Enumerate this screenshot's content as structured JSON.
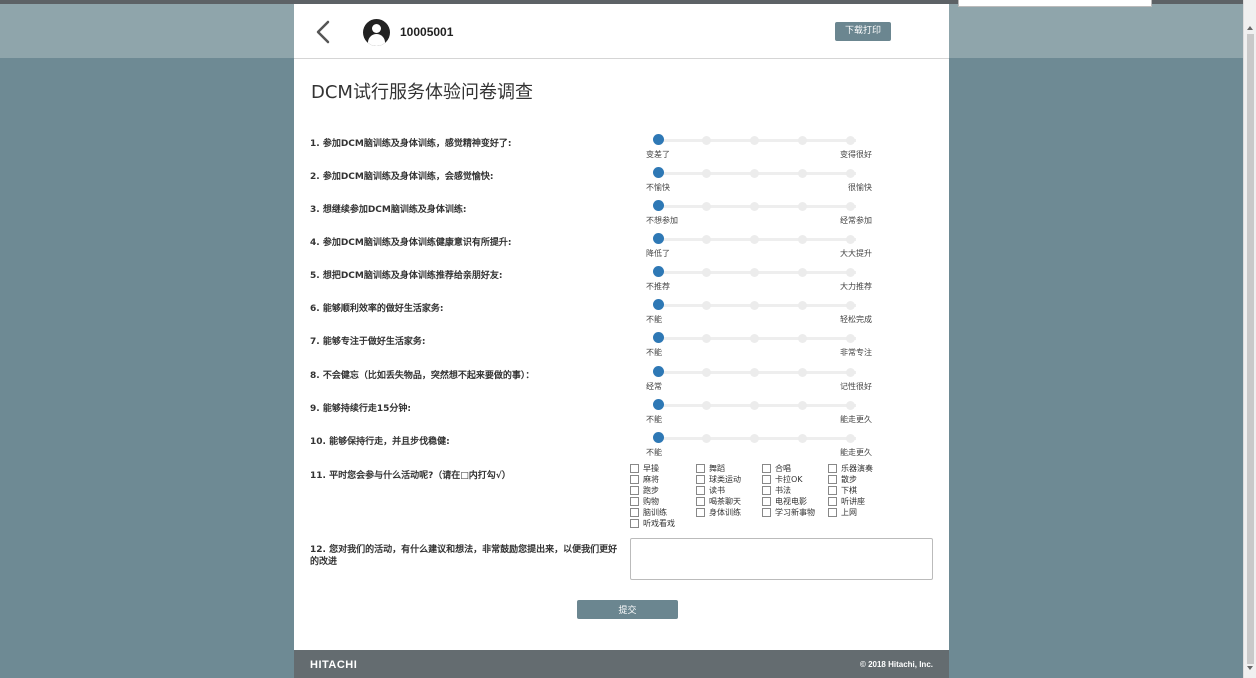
{
  "header": {
    "user_id": "10005001",
    "download_label": "下载打印"
  },
  "survey": {
    "title": "DCM试行服务体验问卷调查",
    "questions": [
      {
        "text": "1. 参加DCM脑训练及身体训练，感觉精神变好了:",
        "left": "变差了",
        "right": "变得很好",
        "value": 1
      },
      {
        "text": "2. 参加DCM脑训练及身体训练，会感觉愉快:",
        "left": "不愉快",
        "right": "很愉快",
        "value": 1
      },
      {
        "text": "3. 想继续参加DCM脑训练及身体训练:",
        "left": "不想参加",
        "right": "经常参加",
        "value": 1
      },
      {
        "text": "4. 参加DCM脑训练及身体训练健康意识有所提升:",
        "left": "降低了",
        "right": "大大提升",
        "value": 1
      },
      {
        "text": "5. 想把DCM脑训练及身体训练推荐给亲朋好友:",
        "left": "不推荐",
        "right": "大力推荐",
        "value": 1
      },
      {
        "text": "6. 能够顺利效率的做好生活家务:",
        "left": "不能",
        "right": "轻松完成",
        "value": 1
      },
      {
        "text": "7. 能够专注于做好生活家务:",
        "left": "不能",
        "right": "非常专注",
        "value": 1
      },
      {
        "text": "8. 不会健忘（比如丢失物品，突然想不起来要做的事）：",
        "left": "经常",
        "right": "记性很好",
        "value": 1
      },
      {
        "text": "9. 能够持续行走15分钟:",
        "left": "不能",
        "right": "能走更久",
        "value": 1
      },
      {
        "text": "10. 能够保持行走，并且步伐稳健:",
        "left": "不能",
        "right": "能走更久",
        "value": 1
      }
    ],
    "activities_question": "11. 平时您会参与什么活动呢?（请在□内打勾√）",
    "activities": [
      "早操",
      "舞蹈",
      "合唱",
      "乐器演奏",
      "麻将",
      "球类运动",
      "卡拉OK",
      "散步",
      "跑步",
      "读书",
      "书法",
      "下棋",
      "购物",
      "喝茶聊天",
      "电视电影",
      "听讲座",
      "脑训练",
      "身体训练",
      "学习新事物",
      "上网",
      "听戏看戏"
    ],
    "feedback_question": "12. 您对我们的活动，有什么建议和想法，非常鼓励您提出来，以便我们更好的改进",
    "feedback_value": "",
    "submit_label": "提交"
  },
  "footer": {
    "brand": "HITACHI",
    "copyright": "© 2018 Hitachi, Inc."
  },
  "colors": {
    "accent": "#6b8690",
    "slider_knob": "#2e78b5",
    "background": "#6e8a94",
    "footer": "#646c70"
  }
}
